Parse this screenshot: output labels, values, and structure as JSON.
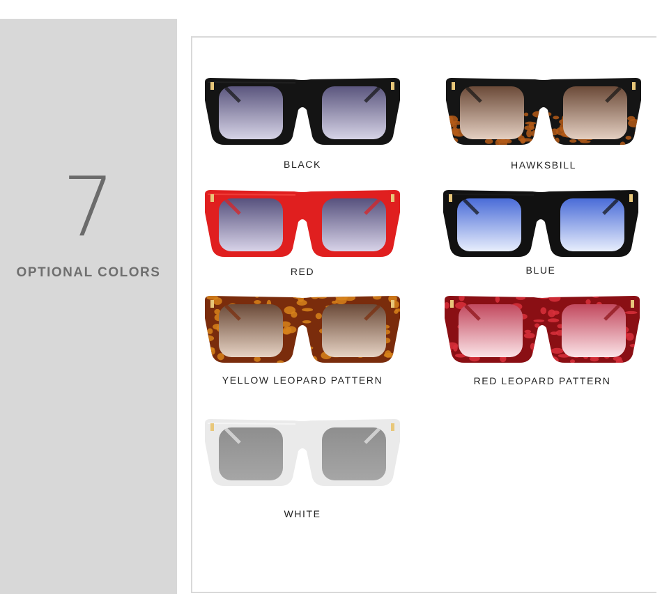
{
  "side": {
    "number": "7",
    "label": "OPTIONAL COLORS"
  },
  "items": [
    {
      "label": "BLACK",
      "frame": "#141414",
      "frame2": "#2a2a2a",
      "lens_top": "#5b567e",
      "lens_bottom": "#d6d3e6",
      "pattern": "none"
    },
    {
      "label": "HAWKSBILL",
      "frame": "#151515",
      "frame2": "#b45a18",
      "lens_top": "#6b4a38",
      "lens_bottom": "#e4cfc1",
      "pattern": "tortoise"
    },
    {
      "label": "RED",
      "frame": "#e01f1f",
      "frame2": "#ff5a50",
      "lens_top": "#57527e",
      "lens_bottom": "#d8d3e8",
      "pattern": "none"
    },
    {
      "label": "BLUE",
      "frame": "#111111",
      "frame2": "#222",
      "lens_top": "#4a6cd8",
      "lens_bottom": "#e8eefc",
      "pattern": "none"
    },
    {
      "label": "YELLOW LEOPARD PATTERN",
      "frame": "#7a2c0c",
      "frame2": "#d7821b",
      "lens_top": "#6b4a38",
      "lens_bottom": "#e6d3c4",
      "pattern": "leopard"
    },
    {
      "label": "RED LEOPARD PATTERN",
      "frame": "#8a0f14",
      "frame2": "#d8303b",
      "lens_top": "#c2495e",
      "lens_bottom": "#fbe3e7",
      "pattern": "leopard"
    },
    {
      "label": "WHITE",
      "frame": "#eaeaea",
      "frame2": "#ffffff",
      "lens_top": "#8e8e8e",
      "lens_bottom": "#a6a6a6",
      "pattern": "none"
    }
  ]
}
